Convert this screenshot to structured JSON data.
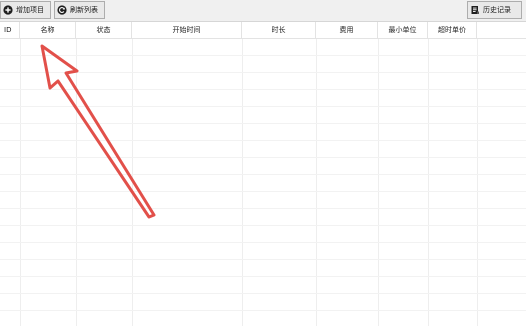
{
  "toolbar": {
    "add_label": "增加项目",
    "refresh_label": "刷新列表",
    "history_label": "历史记录"
  },
  "table": {
    "columns": [
      "ID",
      "名称",
      "状态",
      "开始时间",
      "时长",
      "费用",
      "最小单位",
      "超时单价"
    ],
    "rows": []
  },
  "colors": {
    "annotation_arrow": "#e2504a",
    "grid_line": "#eeeeee",
    "toolbar_bg": "#f0f0f0"
  },
  "icons": {
    "add": "plus-circle-icon",
    "refresh": "refresh-icon",
    "history": "scroll-icon"
  }
}
